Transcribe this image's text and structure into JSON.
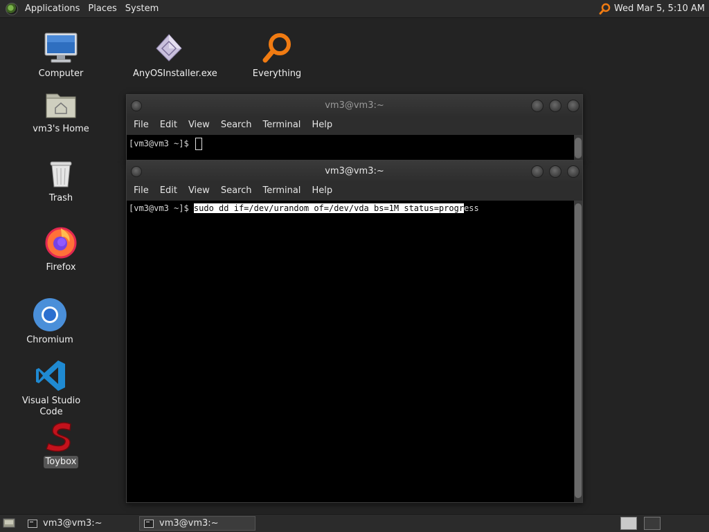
{
  "top_panel": {
    "menus": [
      "Applications",
      "Places",
      "System"
    ],
    "clock": "Wed Mar  5, 5:10 AM"
  },
  "desktop_icons": [
    {
      "label": "Computer",
      "icon": "computer-icon"
    },
    {
      "label": "AnyOSInstaller.exe",
      "icon": "installer-icon"
    },
    {
      "label": "Everything",
      "icon": "search-magnifier-icon"
    },
    {
      "label": "vm3's Home",
      "icon": "home-folder-icon"
    },
    {
      "label": "Trash",
      "icon": "trash-icon"
    },
    {
      "label": "Firefox",
      "icon": "firefox-icon"
    },
    {
      "label": "Chromium",
      "icon": "chromium-icon"
    },
    {
      "label": "Visual Studio Code",
      "icon": "vscode-icon"
    },
    {
      "label": "Toybox",
      "icon": "toybox-icon",
      "selected": true
    }
  ],
  "windows": [
    {
      "title": "vm3@vm3:~",
      "active": false,
      "menu": [
        "File",
        "Edit",
        "View",
        "Search",
        "Terminal",
        "Help"
      ],
      "prompt": "[vm3@vm3 ~]$ ",
      "command": ""
    },
    {
      "title": "vm3@vm3:~",
      "active": true,
      "menu": [
        "File",
        "Edit",
        "View",
        "Search",
        "Terminal",
        "Help"
      ],
      "prompt": "[vm3@vm3 ~]$ ",
      "command_selected": "sudo dd if=/dev/urandom of=/dev/vda bs=1M status=progr",
      "command_rest": "ess"
    }
  ],
  "taskbar": {
    "items": [
      {
        "label": "vm3@vm3:~",
        "active": false
      },
      {
        "label": "vm3@vm3:~",
        "active": true
      }
    ]
  },
  "colors": {
    "desktop_bg": "#232323",
    "panel_bg": "#2b2b2b",
    "accent_orange": "#f07b12",
    "terminal_bg": "#000000",
    "selection_bg": "#ffffff"
  }
}
